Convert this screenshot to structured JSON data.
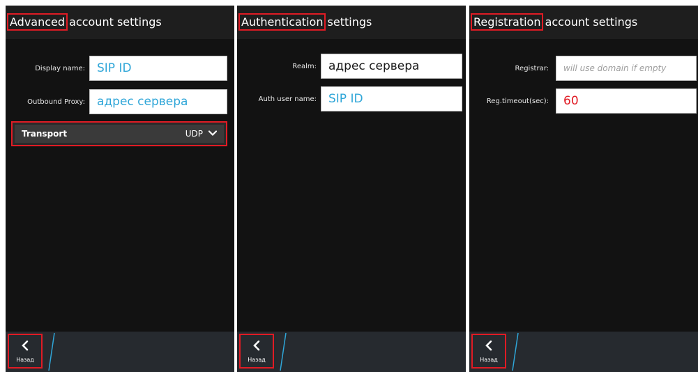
{
  "colors": {
    "accent_outline": "#e01b24",
    "value_blue": "#2fa6d8",
    "value_red": "#e01b24"
  },
  "screens": [
    {
      "title_highlight": "Advanced",
      "title_rest": " account settings",
      "fields": [
        {
          "label": "Display name:",
          "value": "SIP ID"
        },
        {
          "label": "Outbound Proxy:",
          "value": "адрес сервера"
        }
      ],
      "transport": {
        "label": "Transport",
        "value": "UDP",
        "icon": "chevron-down-icon"
      },
      "back_label": "Назад"
    },
    {
      "title_highlight": "Authentication",
      "title_rest": " settings",
      "fields": [
        {
          "label": "Realm:",
          "value": "адрес сервера"
        },
        {
          "label": "Auth user name:",
          "value": "SIP ID"
        }
      ],
      "back_label": "Назад"
    },
    {
      "title_highlight": "Registration",
      "title_rest": " account settings",
      "fields": [
        {
          "label": "Registrar:",
          "value": "",
          "placeholder": "will use domain if empty"
        },
        {
          "label": "Reg.timeout(sec):",
          "value": "60"
        }
      ],
      "back_label": "Назад"
    }
  ]
}
